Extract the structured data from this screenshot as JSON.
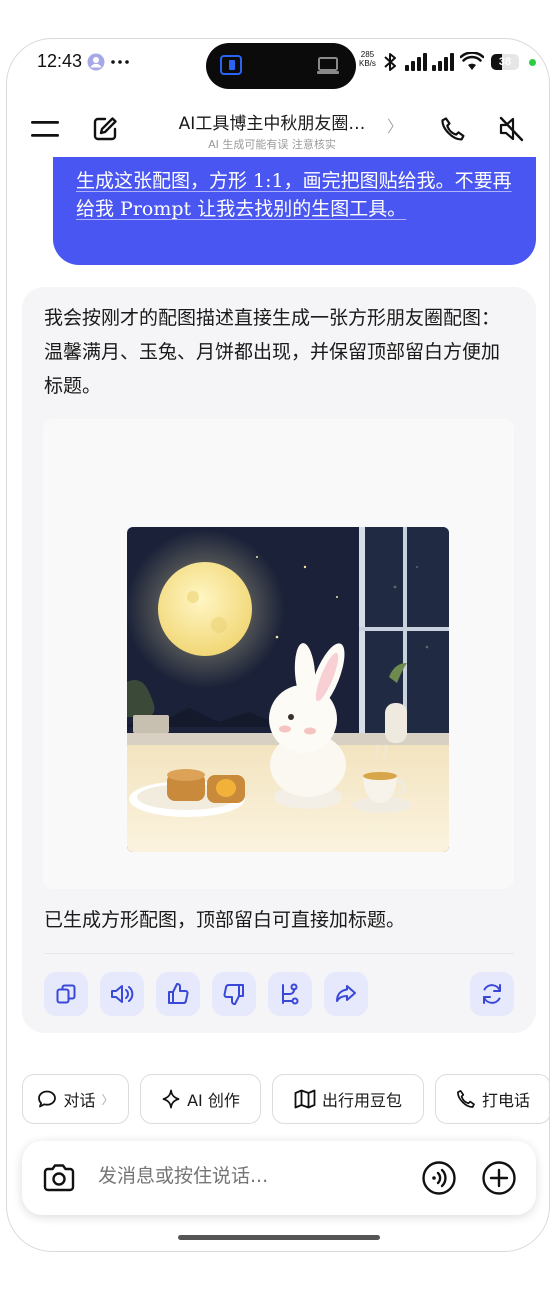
{
  "status_bar": {
    "time": "12:43",
    "net_speed_value": "285",
    "net_speed_unit": "KB/s",
    "battery_level": "38",
    "battery_fraction": 0.38,
    "icons": [
      "avatar-icon",
      "more-icon",
      "tablet-icon",
      "laptop-icon",
      "bluetooth-icon",
      "signal-icon",
      "signal-icon",
      "wifi-icon",
      "battery-icon"
    ]
  },
  "header": {
    "title": "AI工具博主中秋朋友圈…",
    "subtitle": "AI 生成可能有误 注意核实",
    "chevron": "〉"
  },
  "user_message": {
    "text": "生成这张配图，方形 1:1，画完把图贴给我。不要再给我 Prompt 让我去找别的生图工具。"
  },
  "ai_message": {
    "text": "我会按刚才的配图描述直接生成一张方形朋友圈配图：温馨满月、玉兔、月饼都出现，并保留顶部留白方便加标题。",
    "after_image_text": "已生成方形配图，顶部留白可直接加标题。",
    "image_alt": "mid-autumn-moon-rabbit-mooncake-illustration",
    "actions": [
      "copy-icon",
      "speaker-icon",
      "thumbs-up-icon",
      "thumbs-down-icon",
      "branch-icon",
      "share-icon",
      "regenerate-icon"
    ]
  },
  "chips": [
    {
      "label": "对话",
      "icon": "chat-bubble-icon",
      "chevron": "〉"
    },
    {
      "label": "AI 创作",
      "icon": "sparkle-icon"
    },
    {
      "label": "出行用豆包",
      "icon": "map-icon"
    },
    {
      "label": "打电话",
      "icon": "phone-icon"
    }
  ],
  "input": {
    "placeholder": "发消息或按住说话..."
  },
  "colors": {
    "accent": "#4a56f1",
    "icon_blue": "#3a48d8",
    "action_bg": "#e6e8fb",
    "card_bg": "#f5f5f7"
  }
}
